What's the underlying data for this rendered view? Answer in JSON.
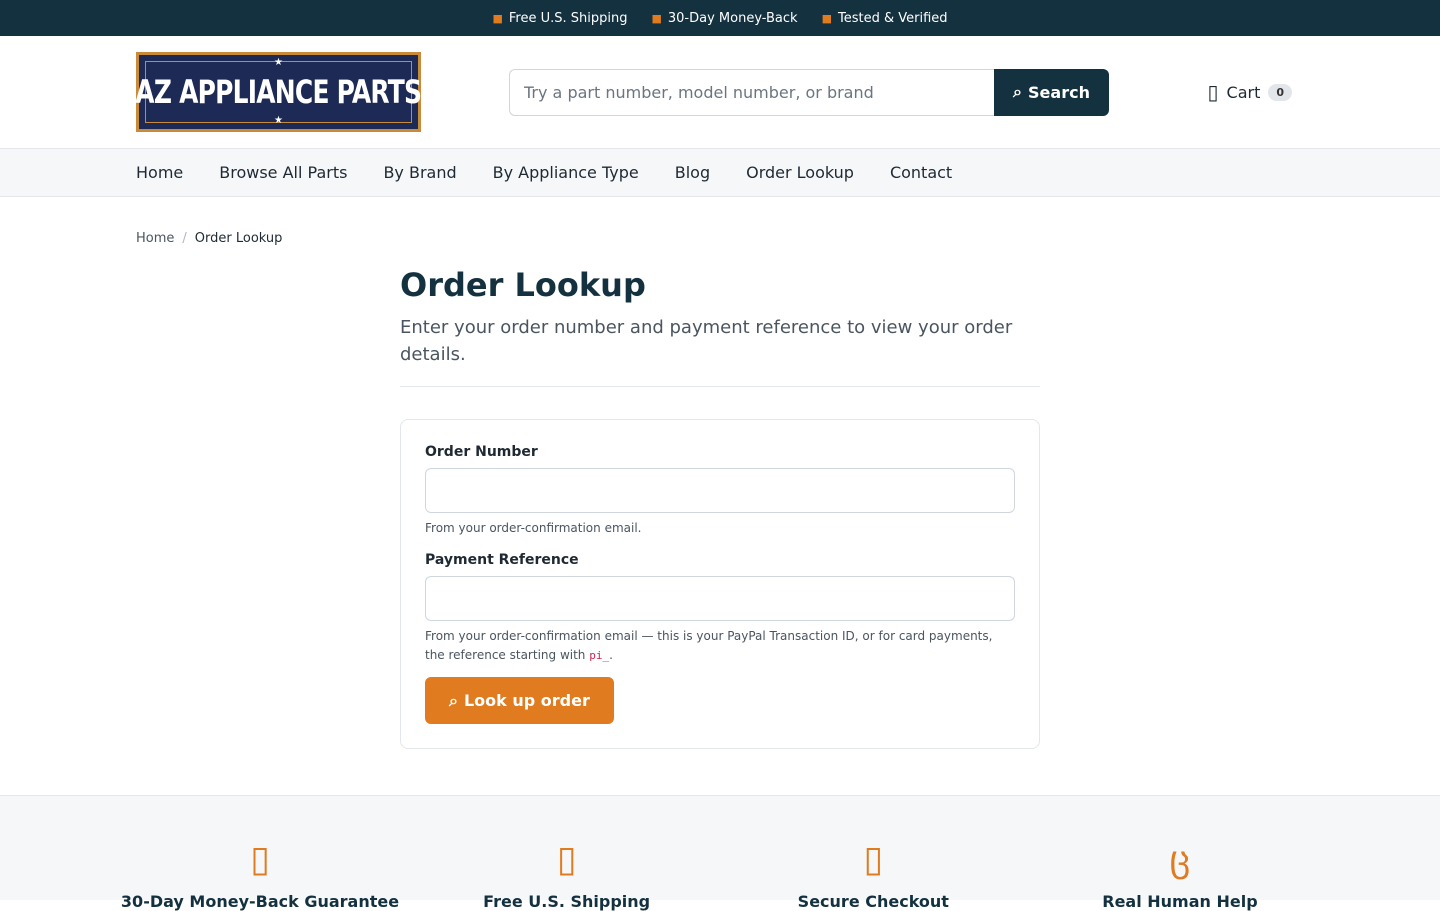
{
  "topbar": {
    "perks": [
      {
        "icon": "truck-icon",
        "label": "Free U.S. Shipping"
      },
      {
        "icon": "refresh-icon",
        "label": "30-Day Money-Back"
      },
      {
        "icon": "check-badge-icon",
        "label": "Tested & Verified"
      }
    ]
  },
  "header": {
    "logo_text": "AZ APPLIANCE PARTS",
    "search": {
      "placeholder": "Try a part number, model number, or brand",
      "button_label": "Search"
    },
    "cart": {
      "label": "Cart",
      "count": "0"
    }
  },
  "nav": {
    "items": [
      "Home",
      "Browse All Parts",
      "By Brand",
      "By Appliance Type",
      "Blog",
      "Order Lookup",
      "Contact"
    ]
  },
  "breadcrumb": {
    "home": "Home",
    "separator": "/",
    "current": "Order Lookup"
  },
  "main": {
    "title": "Order Lookup",
    "lede": "Enter your order number and payment reference to view your order details.",
    "form": {
      "order_number": {
        "label": "Order Number",
        "value": "",
        "help": "From your order-confirmation email."
      },
      "payment_reference": {
        "label": "Payment Reference",
        "value": "",
        "help_prefix": "From your order-confirmation email — this is your PayPal Transaction ID, or for card payments, the reference starting with ",
        "help_code": "pi_",
        "help_suffix": "."
      },
      "submit_label": "Look up order"
    }
  },
  "features": {
    "items": [
      {
        "icon": "shield-icon",
        "label": "30-Day Money-Back Guarantee"
      },
      {
        "icon": "truck-icon",
        "label": "Free U.S. Shipping"
      },
      {
        "icon": "lock-icon",
        "label": "Secure Checkout"
      },
      {
        "icon": "headset-icon",
        "label": "Real Human Help"
      }
    ]
  },
  "colors": {
    "navy": "#143140",
    "accent": "#e07b1f"
  }
}
